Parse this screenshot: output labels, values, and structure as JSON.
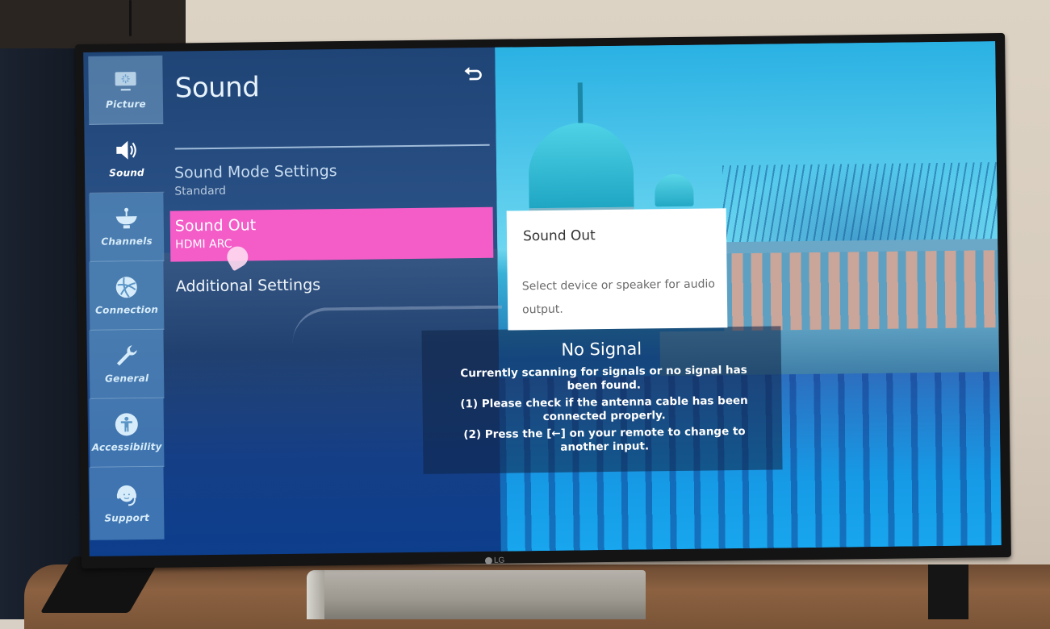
{
  "tv": {
    "brand": "LG"
  },
  "sidebar": {
    "items": [
      {
        "label": "Picture",
        "icon": "picture-icon",
        "active": false
      },
      {
        "label": "Sound",
        "icon": "speaker-icon",
        "active": true
      },
      {
        "label": "Channels",
        "icon": "satellite-dish-icon",
        "active": false
      },
      {
        "label": "Connection",
        "icon": "globe-icon",
        "active": false
      },
      {
        "label": "General",
        "icon": "wrench-icon",
        "active": false
      },
      {
        "label": "Accessibility",
        "icon": "accessibility-icon",
        "active": false
      },
      {
        "label": "Support",
        "icon": "headset-icon",
        "active": false
      }
    ]
  },
  "panel": {
    "title": "Sound",
    "back_icon": "back-arrow-icon",
    "items": [
      {
        "label": "Sound Mode Settings",
        "value": "Standard"
      },
      {
        "label": "Sound Out",
        "value": "HDMI ARC",
        "selected": true
      },
      {
        "label": "Additional Settings",
        "value": ""
      }
    ],
    "highlight_color": "#f45cc8"
  },
  "tooltip": {
    "title": "Sound Out",
    "body": "Select device or speaker for audio output."
  },
  "no_signal": {
    "title": "No Signal",
    "lines": [
      "Currently scanning for signals or no signal has been found.",
      "(1) Please check if the antenna cable has been connected properly.",
      "(2) Press the [←] on your remote to change to another input."
    ]
  }
}
